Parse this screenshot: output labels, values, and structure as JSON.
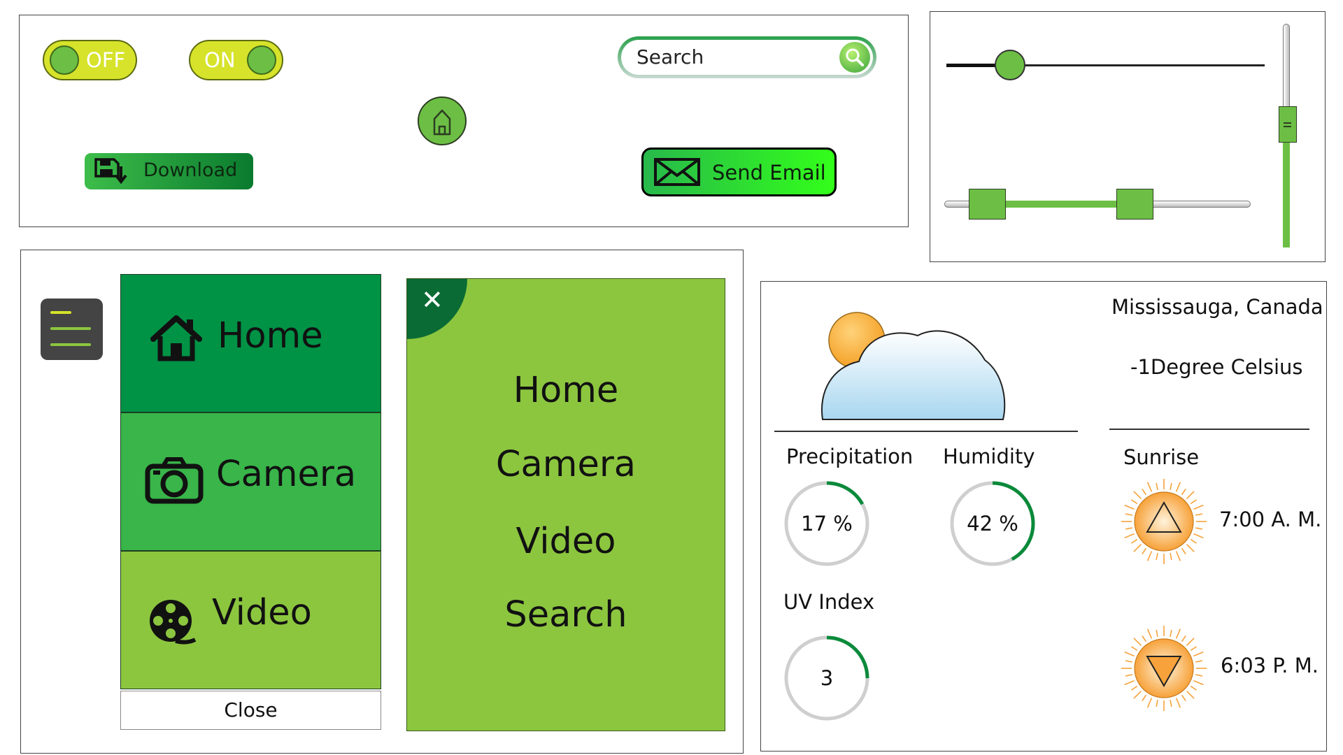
{
  "controls": {
    "toggle_off_label": "OFF",
    "toggle_on_label": "ON",
    "search_placeholder": "Search",
    "download_label": "Download",
    "send_email_label": "Send Email"
  },
  "sliders": {
    "horizontal_value": 0.2,
    "range_low": 0.14,
    "range_high": 0.62,
    "vertical_value": 0.55
  },
  "menu_tiles": {
    "items": [
      {
        "label": "Home",
        "icon": "house-icon",
        "color": "#009245"
      },
      {
        "label": "Camera",
        "icon": "camera-icon",
        "color": "#39b54a"
      },
      {
        "label": "Video",
        "icon": "film-reel-icon",
        "color": "#8cc63f"
      }
    ],
    "close_label": "Close"
  },
  "menu_panel": {
    "close_icon": "close-icon",
    "items": [
      "Home",
      "Camera",
      "Video",
      "Search"
    ]
  },
  "weather": {
    "location": "Mississauga, Canada",
    "temperature": "-1Degree Celsius",
    "precipitation": {
      "label": "Precipitation",
      "value": "17 %",
      "fraction": 0.17
    },
    "humidity": {
      "label": "Humidity",
      "value": "42 %",
      "fraction": 0.42
    },
    "uv_index": {
      "label": "UV Index",
      "value": "3",
      "fraction": 0.25
    },
    "sun": {
      "label": "Sunrise",
      "sunrise_time": "7:00 A. M.",
      "sunset_time": "6:03 P. M."
    }
  },
  "colors": {
    "accent_dark": "#009245",
    "accent_mid": "#39b54a",
    "accent_light": "#8cc63f",
    "toggle": "#d6e32a"
  }
}
